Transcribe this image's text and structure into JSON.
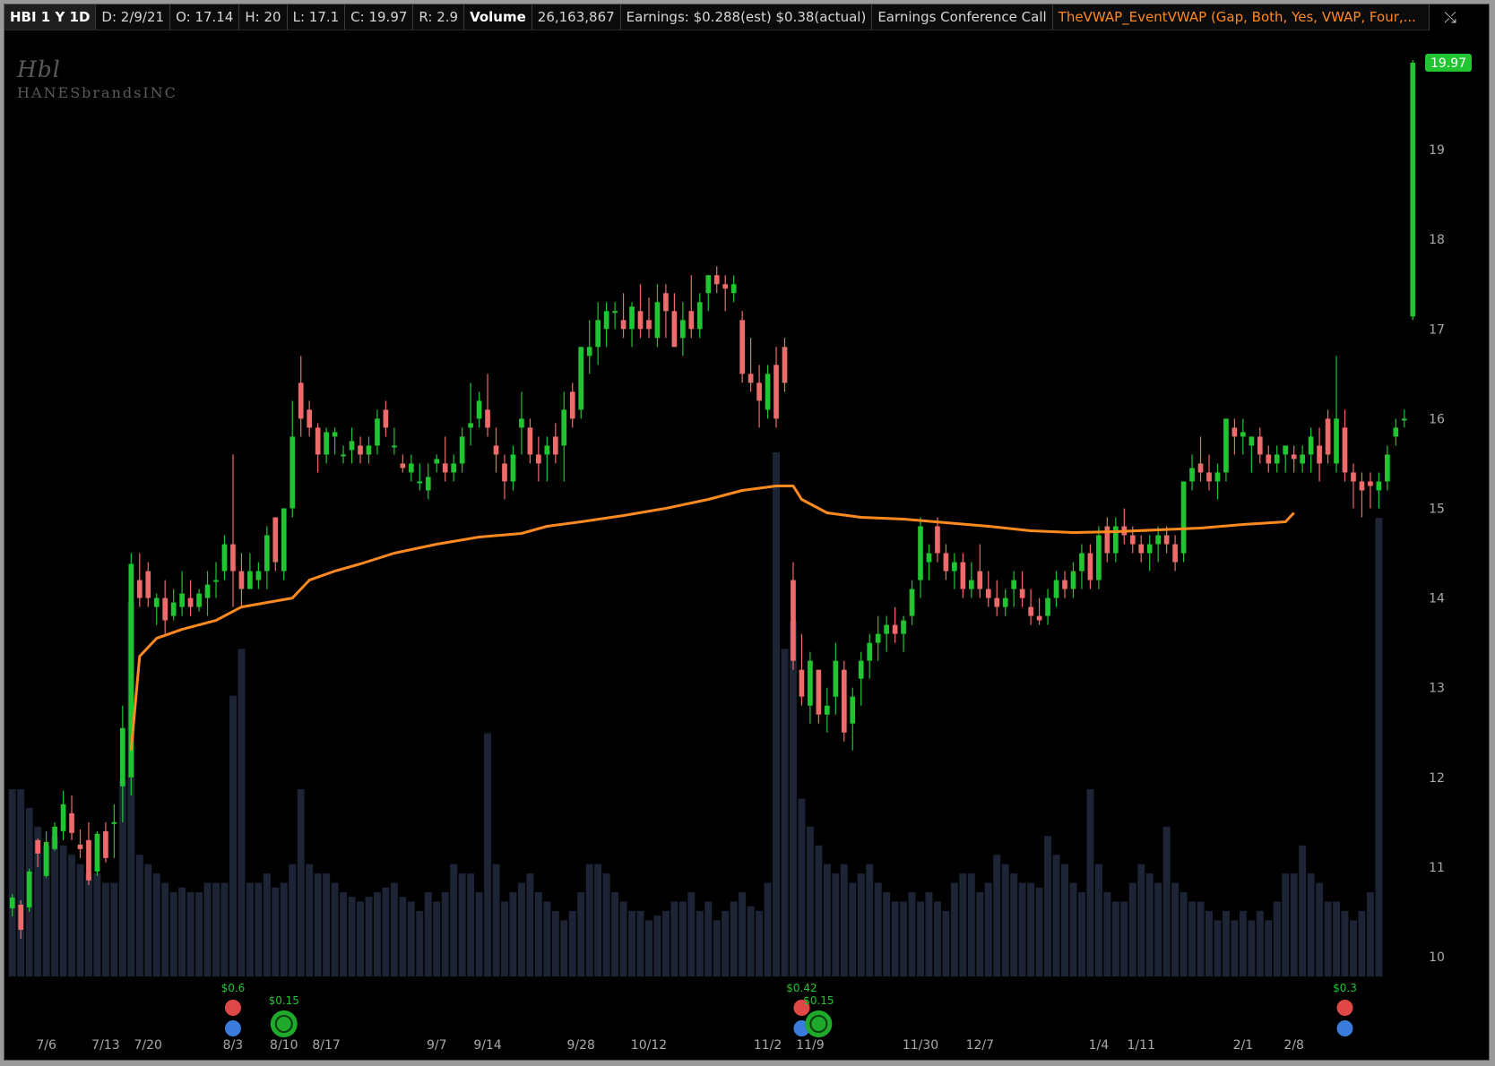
{
  "header": {
    "symbol": "HBI 1 Y 1D",
    "date": "D: 2/9/21",
    "open": "O: 17.14",
    "high": "H: 20",
    "low": "L: 17.1",
    "close": "C: 19.97",
    "range": "R: 2.9",
    "volume_label": "Volume",
    "volume_value": "26,163,867",
    "earnings": "Earnings: $0.288(est) $0.38(actual)",
    "conference": "Earnings Conference Call",
    "study": "TheVWAP_EventVWAP (Gap, Both, Yes, VWAP, Four,..."
  },
  "corner_button": {
    "icon": "crosshair-toggle-icon",
    "glyph": "⤯"
  },
  "logo": {
    "mark": "Hbl",
    "name": "HANESbrandsINC"
  },
  "colors": {
    "up": "#21c431",
    "down": "#ee6b6b",
    "vwap": "#ff8a1f",
    "volume": "#1c2436",
    "grid_text": "#a9a9a9",
    "price_tag": "#21c431"
  },
  "chart_data": {
    "type": "candlestick",
    "price_axis": {
      "min": 9.6,
      "max": 20.0,
      "ticks": [
        10,
        11,
        12,
        13,
        14,
        15,
        16,
        17,
        18,
        19
      ],
      "last_price": "19.97"
    },
    "x_ticks": [
      "7/6",
      "7/13",
      "7/20",
      "8/3",
      "8/10",
      "8/17",
      "9/7",
      "9/14",
      "9/28",
      "10/12",
      "11/2",
      "11/9",
      "11/30",
      "12/7",
      "1/4",
      "1/11",
      "2/1",
      "2/8"
    ],
    "x_tick_bars": [
      4,
      11,
      16,
      26,
      32,
      37,
      50,
      56,
      67,
      75,
      89,
      94,
      107,
      114,
      128,
      133,
      145,
      151
    ],
    "candles": [
      [
        10.54,
        10.7,
        10.45,
        10.66
      ],
      [
        10.58,
        10.63,
        10.2,
        10.3
      ],
      [
        10.55,
        10.98,
        10.5,
        10.95
      ],
      [
        11.3,
        11.32,
        11.0,
        11.15
      ],
      [
        10.9,
        11.4,
        10.88,
        11.28
      ],
      [
        11.2,
        11.5,
        11.18,
        11.45
      ],
      [
        11.4,
        11.85,
        11.3,
        11.7
      ],
      [
        11.6,
        11.8,
        11.3,
        11.38
      ],
      [
        11.25,
        11.42,
        11.1,
        11.2
      ],
      [
        11.3,
        11.5,
        10.8,
        10.85
      ],
      [
        10.95,
        11.4,
        10.9,
        11.37
      ],
      [
        11.4,
        11.5,
        11.05,
        11.1
      ],
      [
        11.5,
        11.7,
        11.1,
        11.5
      ],
      [
        11.9,
        12.8,
        11.5,
        12.55
      ],
      [
        12.0,
        14.5,
        11.8,
        14.38
      ],
      [
        14.2,
        14.5,
        13.9,
        14.0
      ],
      [
        14.3,
        14.4,
        13.9,
        14.0
      ],
      [
        13.9,
        14.05,
        13.7,
        14.0
      ],
      [
        14.0,
        14.2,
        13.6,
        13.75
      ],
      [
        13.8,
        14.1,
        13.75,
        13.95
      ],
      [
        13.9,
        14.3,
        13.8,
        14.05
      ],
      [
        14.0,
        14.2,
        13.8,
        13.9
      ],
      [
        13.9,
        14.1,
        13.85,
        14.05
      ],
      [
        14.0,
        14.3,
        13.8,
        14.15
      ],
      [
        14.2,
        14.4,
        14.0,
        14.2
      ],
      [
        14.3,
        14.7,
        14.2,
        14.6
      ],
      [
        14.6,
        15.6,
        13.9,
        14.3
      ],
      [
        14.3,
        14.5,
        13.9,
        14.1
      ],
      [
        14.1,
        14.5,
        14.1,
        14.3
      ],
      [
        14.2,
        14.4,
        14.1,
        14.3
      ],
      [
        14.3,
        14.8,
        14.1,
        14.7
      ],
      [
        14.9,
        14.9,
        14.3,
        14.4
      ],
      [
        14.3,
        14.9,
        14.2,
        15.0
      ],
      [
        15.0,
        16.2,
        14.9,
        15.8
      ],
      [
        16.4,
        16.7,
        15.8,
        16.0
      ],
      [
        16.1,
        16.2,
        15.8,
        15.9
      ],
      [
        15.9,
        15.95,
        15.4,
        15.6
      ],
      [
        15.6,
        15.9,
        15.5,
        15.85
      ],
      [
        15.8,
        15.9,
        15.6,
        15.85
      ],
      [
        15.6,
        15.7,
        15.5,
        15.6
      ],
      [
        15.65,
        15.9,
        15.5,
        15.75
      ],
      [
        15.7,
        15.8,
        15.5,
        15.6
      ],
      [
        15.6,
        15.8,
        15.5,
        15.7
      ],
      [
        15.7,
        16.1,
        15.6,
        16.0
      ],
      [
        16.1,
        16.2,
        15.8,
        15.9
      ],
      [
        15.7,
        15.9,
        15.6,
        15.7
      ],
      [
        15.5,
        15.6,
        15.4,
        15.45
      ],
      [
        15.4,
        15.6,
        15.3,
        15.5
      ],
      [
        15.3,
        15.5,
        15.2,
        15.3
      ],
      [
        15.2,
        15.5,
        15.1,
        15.35
      ],
      [
        15.5,
        15.6,
        15.4,
        15.55
      ],
      [
        15.5,
        15.8,
        15.3,
        15.4
      ],
      [
        15.4,
        15.6,
        15.3,
        15.5
      ],
      [
        15.5,
        15.9,
        15.4,
        15.8
      ],
      [
        15.9,
        16.4,
        15.7,
        15.95
      ],
      [
        16.0,
        16.3,
        15.9,
        16.2
      ],
      [
        16.1,
        16.5,
        15.8,
        15.9
      ],
      [
        15.7,
        15.9,
        15.4,
        15.6
      ],
      [
        15.5,
        15.6,
        15.1,
        15.3
      ],
      [
        15.3,
        15.7,
        15.2,
        15.6
      ],
      [
        15.9,
        16.3,
        15.6,
        16.0
      ],
      [
        15.9,
        16.0,
        15.5,
        15.6
      ],
      [
        15.6,
        15.8,
        15.3,
        15.5
      ],
      [
        15.6,
        15.8,
        15.3,
        15.7
      ],
      [
        15.8,
        15.95,
        15.5,
        15.6
      ],
      [
        15.7,
        16.3,
        15.3,
        16.1
      ],
      [
        16.3,
        16.4,
        15.9,
        16.0
      ],
      [
        16.1,
        16.8,
        16.0,
        16.8
      ],
      [
        16.7,
        17.1,
        16.5,
        16.8
      ],
      [
        16.8,
        17.3,
        16.6,
        17.1
      ],
      [
        17.0,
        17.3,
        16.8,
        17.2
      ],
      [
        17.2,
        17.3,
        17.0,
        17.2
      ],
      [
        17.1,
        17.4,
        16.9,
        17.0
      ],
      [
        17.0,
        17.3,
        16.8,
        17.25
      ],
      [
        17.2,
        17.5,
        16.9,
        17.0
      ],
      [
        17.1,
        17.35,
        16.9,
        17.0
      ],
      [
        16.9,
        17.5,
        16.8,
        17.3
      ],
      [
        17.4,
        17.5,
        16.9,
        17.2
      ],
      [
        17.2,
        17.4,
        16.8,
        16.8
      ],
      [
        16.9,
        17.3,
        16.7,
        17.1
      ],
      [
        17.2,
        17.6,
        16.9,
        17.0
      ],
      [
        17.0,
        17.4,
        16.9,
        17.3
      ],
      [
        17.4,
        17.6,
        17.2,
        17.6
      ],
      [
        17.6,
        17.7,
        17.4,
        17.5
      ],
      [
        17.5,
        17.6,
        17.2,
        17.45
      ],
      [
        17.4,
        17.6,
        17.3,
        17.5
      ],
      [
        17.1,
        17.2,
        16.4,
        16.5
      ],
      [
        16.5,
        16.9,
        16.3,
        16.4
      ],
      [
        16.4,
        16.6,
        15.9,
        16.2
      ],
      [
        16.1,
        16.6,
        16.0,
        16.5
      ],
      [
        16.6,
        16.8,
        15.9,
        16.0
      ],
      [
        16.8,
        16.9,
        16.3,
        16.4
      ],
      [
        14.2,
        14.4,
        13.2,
        13.3
      ],
      [
        13.2,
        13.6,
        12.8,
        12.9
      ],
      [
        12.8,
        13.4,
        12.6,
        13.3
      ],
      [
        13.2,
        13.2,
        12.6,
        12.7
      ],
      [
        12.7,
        13.0,
        12.5,
        12.8
      ],
      [
        12.9,
        13.5,
        12.7,
        13.3
      ],
      [
        13.2,
        13.3,
        12.4,
        12.5
      ],
      [
        12.6,
        13.0,
        12.3,
        12.9
      ],
      [
        13.1,
        13.4,
        12.8,
        13.3
      ],
      [
        13.3,
        13.6,
        13.1,
        13.5
      ],
      [
        13.5,
        13.8,
        13.3,
        13.6
      ],
      [
        13.6,
        13.8,
        13.4,
        13.7
      ],
      [
        13.7,
        13.9,
        13.5,
        13.6
      ],
      [
        13.6,
        13.8,
        13.4,
        13.75
      ],
      [
        13.8,
        14.2,
        13.7,
        14.1
      ],
      [
        14.2,
        14.9,
        14.0,
        14.8
      ],
      [
        14.4,
        14.6,
        14.2,
        14.5
      ],
      [
        14.8,
        14.9,
        14.4,
        14.5
      ],
      [
        14.5,
        14.6,
        14.2,
        14.3
      ],
      [
        14.3,
        14.5,
        14.1,
        14.4
      ],
      [
        14.4,
        14.5,
        14.0,
        14.1
      ],
      [
        14.1,
        14.4,
        14.0,
        14.2
      ],
      [
        14.3,
        14.6,
        14.0,
        14.1
      ],
      [
        14.1,
        14.3,
        13.9,
        14.0
      ],
      [
        14.0,
        14.2,
        13.8,
        13.9
      ],
      [
        13.9,
        14.1,
        13.8,
        14.0
      ],
      [
        14.1,
        14.3,
        13.9,
        14.2
      ],
      [
        14.1,
        14.3,
        13.9,
        14.0
      ],
      [
        13.9,
        14.1,
        13.7,
        13.8
      ],
      [
        13.8,
        14.0,
        13.7,
        13.75
      ],
      [
        13.8,
        14.1,
        13.7,
        14.0
      ],
      [
        14.0,
        14.3,
        13.9,
        14.2
      ],
      [
        14.2,
        14.3,
        14.0,
        14.1
      ],
      [
        14.1,
        14.4,
        14.0,
        14.3
      ],
      [
        14.3,
        14.6,
        14.1,
        14.5
      ],
      [
        14.5,
        14.6,
        14.1,
        14.2
      ],
      [
        14.2,
        14.8,
        14.1,
        14.7
      ],
      [
        14.8,
        14.9,
        14.4,
        14.5
      ],
      [
        14.5,
        14.9,
        14.4,
        14.8
      ],
      [
        14.8,
        15.0,
        14.6,
        14.7
      ],
      [
        14.7,
        14.8,
        14.5,
        14.6
      ],
      [
        14.6,
        14.7,
        14.4,
        14.5
      ],
      [
        14.5,
        14.7,
        14.3,
        14.6
      ],
      [
        14.6,
        14.8,
        14.4,
        14.7
      ],
      [
        14.7,
        14.8,
        14.5,
        14.6
      ],
      [
        14.6,
        14.7,
        14.3,
        14.4
      ],
      [
        14.5,
        15.3,
        14.4,
        15.3
      ],
      [
        15.3,
        15.6,
        15.2,
        15.45
      ],
      [
        15.5,
        15.8,
        15.3,
        15.4
      ],
      [
        15.4,
        15.6,
        15.2,
        15.3
      ],
      [
        15.3,
        15.5,
        15.1,
        15.4
      ],
      [
        15.4,
        16.0,
        15.3,
        16.0
      ],
      [
        15.9,
        16.0,
        15.6,
        15.8
      ],
      [
        15.8,
        16.0,
        15.6,
        15.85
      ],
      [
        15.7,
        15.8,
        15.4,
        15.8
      ],
      [
        15.8,
        15.9,
        15.5,
        15.6
      ],
      [
        15.6,
        15.7,
        15.4,
        15.5
      ],
      [
        15.5,
        15.7,
        15.4,
        15.6
      ],
      [
        15.6,
        15.7,
        15.4,
        15.7
      ],
      [
        15.6,
        15.7,
        15.4,
        15.55
      ],
      [
        15.5,
        15.7,
        15.4,
        15.6
      ],
      [
        15.6,
        15.9,
        15.4,
        15.8
      ],
      [
        15.7,
        15.9,
        15.3,
        15.5
      ],
      [
        16.0,
        16.1,
        15.5,
        15.6
      ],
      [
        15.5,
        16.7,
        15.4,
        16.0
      ],
      [
        15.9,
        16.1,
        15.3,
        15.4
      ],
      [
        15.4,
        15.5,
        15.0,
        15.3
      ],
      [
        15.3,
        15.4,
        14.9,
        15.2
      ],
      [
        15.3,
        15.4,
        15.0,
        15.25
      ],
      [
        15.2,
        15.4,
        15.0,
        15.3
      ],
      [
        15.3,
        15.7,
        15.2,
        15.6
      ],
      [
        15.8,
        16.0,
        15.7,
        15.9
      ],
      [
        16.0,
        16.1,
        15.9,
        16.0
      ],
      [
        17.14,
        20.0,
        17.1,
        19.97
      ]
    ],
    "volume_bars": [
      2.0,
      2.0,
      1.8,
      1.6,
      1.4,
      1.5,
      1.4,
      1.3,
      1.2,
      1.1,
      1.1,
      1.0,
      1.0,
      2.1,
      4.0,
      1.3,
      1.2,
      1.1,
      1.0,
      0.9,
      0.95,
      0.9,
      0.9,
      1.0,
      1.0,
      1.0,
      3.0,
      3.5,
      1.0,
      1.0,
      1.1,
      0.95,
      1.0,
      1.2,
      2.0,
      1.2,
      1.1,
      1.1,
      1.0,
      0.9,
      0.85,
      0.8,
      0.85,
      0.9,
      0.95,
      1.0,
      0.85,
      0.8,
      0.7,
      0.9,
      0.8,
      0.9,
      1.2,
      1.1,
      1.1,
      0.9,
      2.6,
      1.2,
      0.8,
      0.9,
      1.0,
      1.1,
      0.9,
      0.8,
      0.7,
      0.6,
      0.7,
      0.9,
      1.2,
      1.2,
      1.1,
      0.9,
      0.8,
      0.7,
      0.7,
      0.6,
      0.65,
      0.7,
      0.8,
      0.8,
      0.9,
      0.7,
      0.8,
      0.6,
      0.7,
      0.8,
      0.9,
      0.75,
      0.7,
      1.0,
      5.6,
      3.5,
      3.8,
      1.9,
      1.6,
      1.4,
      1.2,
      1.1,
      1.2,
      1.0,
      1.1,
      1.2,
      1.0,
      0.9,
      0.8,
      0.8,
      0.9,
      0.8,
      0.9,
      0.8,
      0.7,
      1.0,
      1.1,
      1.1,
      0.9,
      1.0,
      1.3,
      1.2,
      1.1,
      1.0,
      1.0,
      0.95,
      1.5,
      1.3,
      1.2,
      1.0,
      0.9,
      2.0,
      1.2,
      0.9,
      0.8,
      0.8,
      1.0,
      1.2,
      1.1,
      1.0,
      1.6,
      1.0,
      0.9,
      0.8,
      0.8,
      0.7,
      0.6,
      0.7,
      0.6,
      0.7,
      0.6,
      0.7,
      0.6,
      0.8,
      1.1,
      1.1,
      1.4,
      1.1,
      1.0,
      0.8,
      0.8,
      0.7,
      0.6,
      0.7,
      0.9,
      4.9
    ],
    "vwap": {
      "name": "TheVWAP_EventVWAP",
      "anchors": [
        [
          14,
          12.3
        ],
        [
          15,
          13.35
        ],
        [
          17,
          13.55
        ],
        [
          20,
          13.65
        ],
        [
          24,
          13.75
        ],
        [
          27,
          13.9
        ],
        [
          30,
          13.95
        ],
        [
          33,
          14.0
        ],
        [
          35,
          14.2
        ],
        [
          38,
          14.3
        ],
        [
          41,
          14.38
        ],
        [
          45,
          14.5
        ],
        [
          50,
          14.6
        ],
        [
          55,
          14.68
        ],
        [
          60,
          14.72
        ],
        [
          63,
          14.8
        ],
        [
          67,
          14.85
        ],
        [
          72,
          14.92
        ],
        [
          77,
          15.0
        ],
        [
          82,
          15.1
        ],
        [
          86,
          15.2
        ],
        [
          90,
          15.25
        ],
        [
          92,
          15.25
        ],
        [
          93,
          15.1
        ],
        [
          96,
          14.95
        ],
        [
          100,
          14.9
        ],
        [
          105,
          14.88
        ],
        [
          110,
          14.84
        ],
        [
          115,
          14.8
        ],
        [
          120,
          14.75
        ],
        [
          125,
          14.73
        ],
        [
          130,
          14.74
        ],
        [
          135,
          14.76
        ],
        [
          140,
          14.78
        ],
        [
          145,
          14.82
        ],
        [
          150,
          14.85
        ],
        [
          151,
          14.95
        ]
      ]
    },
    "event_markers": [
      {
        "bar": 26,
        "label": "$0.6",
        "type": "earnings",
        "label_color": "#21c431"
      },
      {
        "bar": 32,
        "label": "$0.15",
        "type": "dividend",
        "label_color": "#21c431"
      },
      {
        "bar": 93,
        "label": "$0.42",
        "type": "earnings",
        "label_color": "#21c431"
      },
      {
        "bar": 95,
        "label": "$0.15",
        "type": "dividend",
        "label_color": "#21c431"
      },
      {
        "bar": 157,
        "label": "$0.3",
        "type": "earnings",
        "label_color": "#21c431"
      }
    ]
  }
}
